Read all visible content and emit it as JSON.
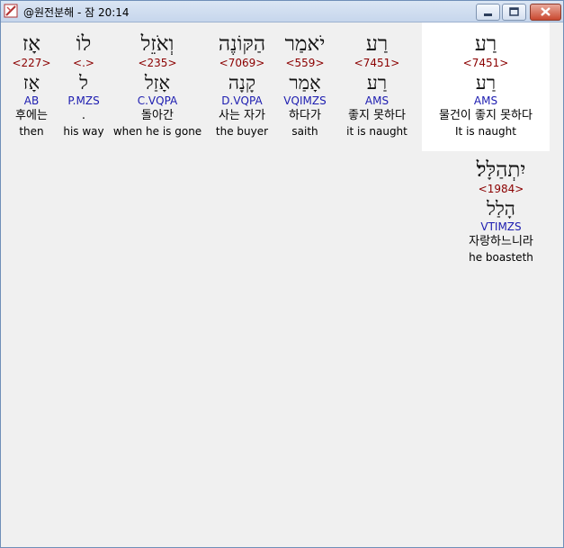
{
  "window": {
    "title": "@원전분해 - 잠 20:14"
  },
  "words": [
    {
      "hebrew": "רַע",
      "strong": "<7451>",
      "lemma": "רַע",
      "parse": "AMS",
      "korean": "물건이 좋지 못하다",
      "english": "It is naught",
      "selected": true
    },
    {
      "hebrew": "רַע",
      "strong": "<7451>",
      "lemma": "רַע",
      "parse": "AMS",
      "korean": "좋지 못하다",
      "english": "it is naught"
    },
    {
      "hebrew": "יֹאמַר",
      "strong": "<559>",
      "lemma": "אָמַר",
      "parse": "VQIMZS",
      "korean": "하다가",
      "english": "saith"
    },
    {
      "hebrew": "הַקּוֹנֶה",
      "strong": "<7069>",
      "lemma": "קָנָה",
      "parse": "D.VQPA",
      "korean": "사는 자가",
      "english": "the buyer"
    },
    {
      "hebrew": "וְאֹזֵל",
      "strong": "<235>",
      "lemma": "אָזַל",
      "parse": "C.VQPA",
      "korean": "돌아간",
      "english": "when he is gone"
    },
    {
      "hebrew": "לוֹ",
      "strong": "<.>",
      "lemma": "ל",
      "parse": "P.MZS",
      "korean": ".",
      "english": "his way"
    },
    {
      "hebrew": "אָז",
      "strong": "<227>",
      "lemma": "אָז",
      "parse": "AB",
      "korean": "후에는",
      "english": "then"
    },
    {
      "hebrew": "יִתְהַלָּל׃",
      "strong": "<1984>",
      "lemma": "הָלַל",
      "parse": "VTIMZS",
      "korean": "자랑하느니라",
      "english": "he boasteth"
    }
  ]
}
